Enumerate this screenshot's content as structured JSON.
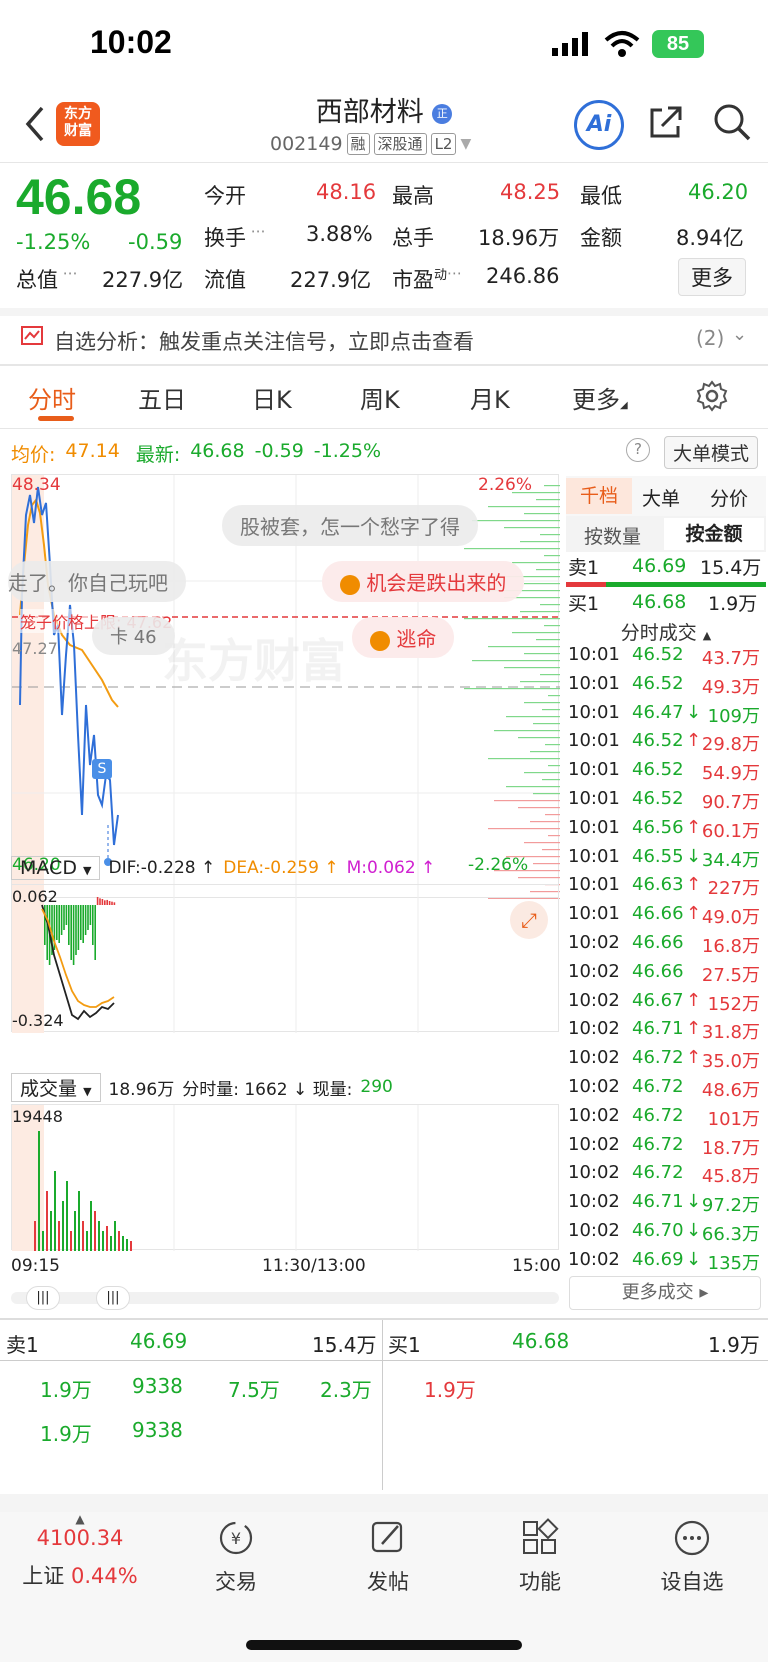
{
  "status": {
    "time": "10:02",
    "battery": "85"
  },
  "header": {
    "logo_line1": "东方",
    "logo_line2": "财富",
    "title": "西部材料",
    "title_badge": "正",
    "code": "002149",
    "tags": [
      "融",
      "深股通",
      "L2"
    ],
    "ai_label": "Ai"
  },
  "quote": {
    "price": "46.68",
    "pct": "-1.25%",
    "chg": "-0.59",
    "r1": [
      {
        "label": "今开",
        "value": "48.16"
      },
      {
        "label": "最高",
        "value": "48.25"
      },
      {
        "label": "最低",
        "value": "46.20"
      }
    ],
    "r2": [
      {
        "label": "换手",
        "value": "3.88%"
      },
      {
        "label": "总手",
        "value": "18.96万"
      },
      {
        "label": "金额",
        "value": "8.94亿"
      }
    ],
    "r3": [
      {
        "label": "总值",
        "value": "227.9亿"
      },
      {
        "label": "流值",
        "value": "227.9亿"
      },
      {
        "label": "市盈",
        "sup": "动",
        "value": "246.86"
      }
    ],
    "more": "更多"
  },
  "banner": {
    "text": "自选分析：触发重点关注信号，立即点击查看",
    "count": "(2)"
  },
  "tabs": [
    "分时",
    "五日",
    "日K",
    "周K",
    "月K",
    "更多"
  ],
  "chartinfo": {
    "avg_label": "均价:",
    "avg": "47.14",
    "last_label": "最新:",
    "last": "46.68",
    "chg": "-0.59",
    "pct": "-1.25%",
    "bigmode": "大单模式"
  },
  "chart": {
    "ymax": "48.34",
    "ymin": "46.20",
    "mid": "47.27",
    "pmax": "2.26%",
    "pmin": "-2.26%",
    "limit": "笼子价格上限: 47.62",
    "marker": "S"
  },
  "bubbles": {
    "b1": "股被套，怎一个愁字了得",
    "b2": "走了。你自己玩吧",
    "b3": "机会是跌出来的",
    "b4": "卡 46",
    "b5": "逃命",
    "watermark": "东方财富"
  },
  "macd": {
    "name": "MACD",
    "dif": "DIF:-0.228 ↑",
    "dea": "DEA:-0.259 ↑",
    "m": "M:0.062 ↑",
    "top": "0.062",
    "bottom": "-0.324"
  },
  "volume": {
    "name": "成交量",
    "total": "18.96万",
    "label": "分时量: 1662 ↓ 现量:",
    "now": "290",
    "max": "19448"
  },
  "time_axis": [
    "09:15",
    "11:30/13:00",
    "15:00"
  ],
  "right_tabs": [
    "千档",
    "大单",
    "分价"
  ],
  "right_tabs2": [
    "按数量",
    "按金额"
  ],
  "sell1": {
    "label": "卖1",
    "price": "46.69",
    "vol": "15.4万"
  },
  "buy1": {
    "label": "买1",
    "price": "46.68",
    "vol": "1.9万"
  },
  "trades_title": "分时成交",
  "trades": [
    {
      "t": "10:01",
      "p": "46.52",
      "a": "",
      "v": "43.7万",
      "c": "red"
    },
    {
      "t": "10:01",
      "p": "46.52",
      "a": "",
      "v": "49.3万",
      "c": "red"
    },
    {
      "t": "10:01",
      "p": "46.47",
      "a": "↓",
      "v": "109万",
      "c": "green"
    },
    {
      "t": "10:01",
      "p": "46.52",
      "a": "↑",
      "v": "29.8万",
      "c": "red"
    },
    {
      "t": "10:01",
      "p": "46.52",
      "a": "",
      "v": "54.9万",
      "c": "red"
    },
    {
      "t": "10:01",
      "p": "46.52",
      "a": "",
      "v": "90.7万",
      "c": "red"
    },
    {
      "t": "10:01",
      "p": "46.56",
      "a": "↑",
      "v": "60.1万",
      "c": "red"
    },
    {
      "t": "10:01",
      "p": "46.55",
      "a": "↓",
      "v": "34.4万",
      "c": "green"
    },
    {
      "t": "10:01",
      "p": "46.63",
      "a": "↑",
      "v": "227万",
      "c": "red"
    },
    {
      "t": "10:01",
      "p": "46.66",
      "a": "↑",
      "v": "49.0万",
      "c": "red"
    },
    {
      "t": "10:02",
      "p": "46.66",
      "a": "",
      "v": "16.8万",
      "c": "red"
    },
    {
      "t": "10:02",
      "p": "46.66",
      "a": "",
      "v": "27.5万",
      "c": "red"
    },
    {
      "t": "10:02",
      "p": "46.67",
      "a": "↑",
      "v": "152万",
      "c": "red"
    },
    {
      "t": "10:02",
      "p": "46.71",
      "a": "↑",
      "v": "31.8万",
      "c": "red"
    },
    {
      "t": "10:02",
      "p": "46.72",
      "a": "↑",
      "v": "35.0万",
      "c": "red"
    },
    {
      "t": "10:02",
      "p": "46.72",
      "a": "",
      "v": "48.6万",
      "c": "red"
    },
    {
      "t": "10:02",
      "p": "46.72",
      "a": "",
      "v": "101万",
      "c": "red"
    },
    {
      "t": "10:02",
      "p": "46.72",
      "a": "",
      "v": "18.7万",
      "c": "red"
    },
    {
      "t": "10:02",
      "p": "46.72",
      "a": "",
      "v": "45.8万",
      "c": "red"
    },
    {
      "t": "10:02",
      "p": "46.71",
      "a": "↓",
      "v": "97.2万",
      "c": "green"
    },
    {
      "t": "10:02",
      "p": "46.70",
      "a": "↓",
      "v": "66.3万",
      "c": "green"
    },
    {
      "t": "10:02",
      "p": "46.69",
      "a": "↓",
      "v": "135万",
      "c": "green"
    }
  ],
  "more_trades": "更多成交",
  "queue": {
    "sell_label": "卖1",
    "sell_price": "46.69",
    "sell_vol": "15.4万",
    "buy_label": "买1",
    "buy_price": "46.68",
    "buy_vol": "1.9万",
    "sell_row1": [
      "1.9万",
      "9338",
      "7.5万",
      "2.3万"
    ],
    "sell_row2": [
      "1.9万",
      "9338"
    ],
    "buy_row1": [
      "1.9万"
    ]
  },
  "bottom": {
    "index_value": "4100.34",
    "index_name": "上证",
    "index_pct": "0.44%",
    "items": [
      "交易",
      "发帖",
      "功能",
      "设自选"
    ]
  }
}
